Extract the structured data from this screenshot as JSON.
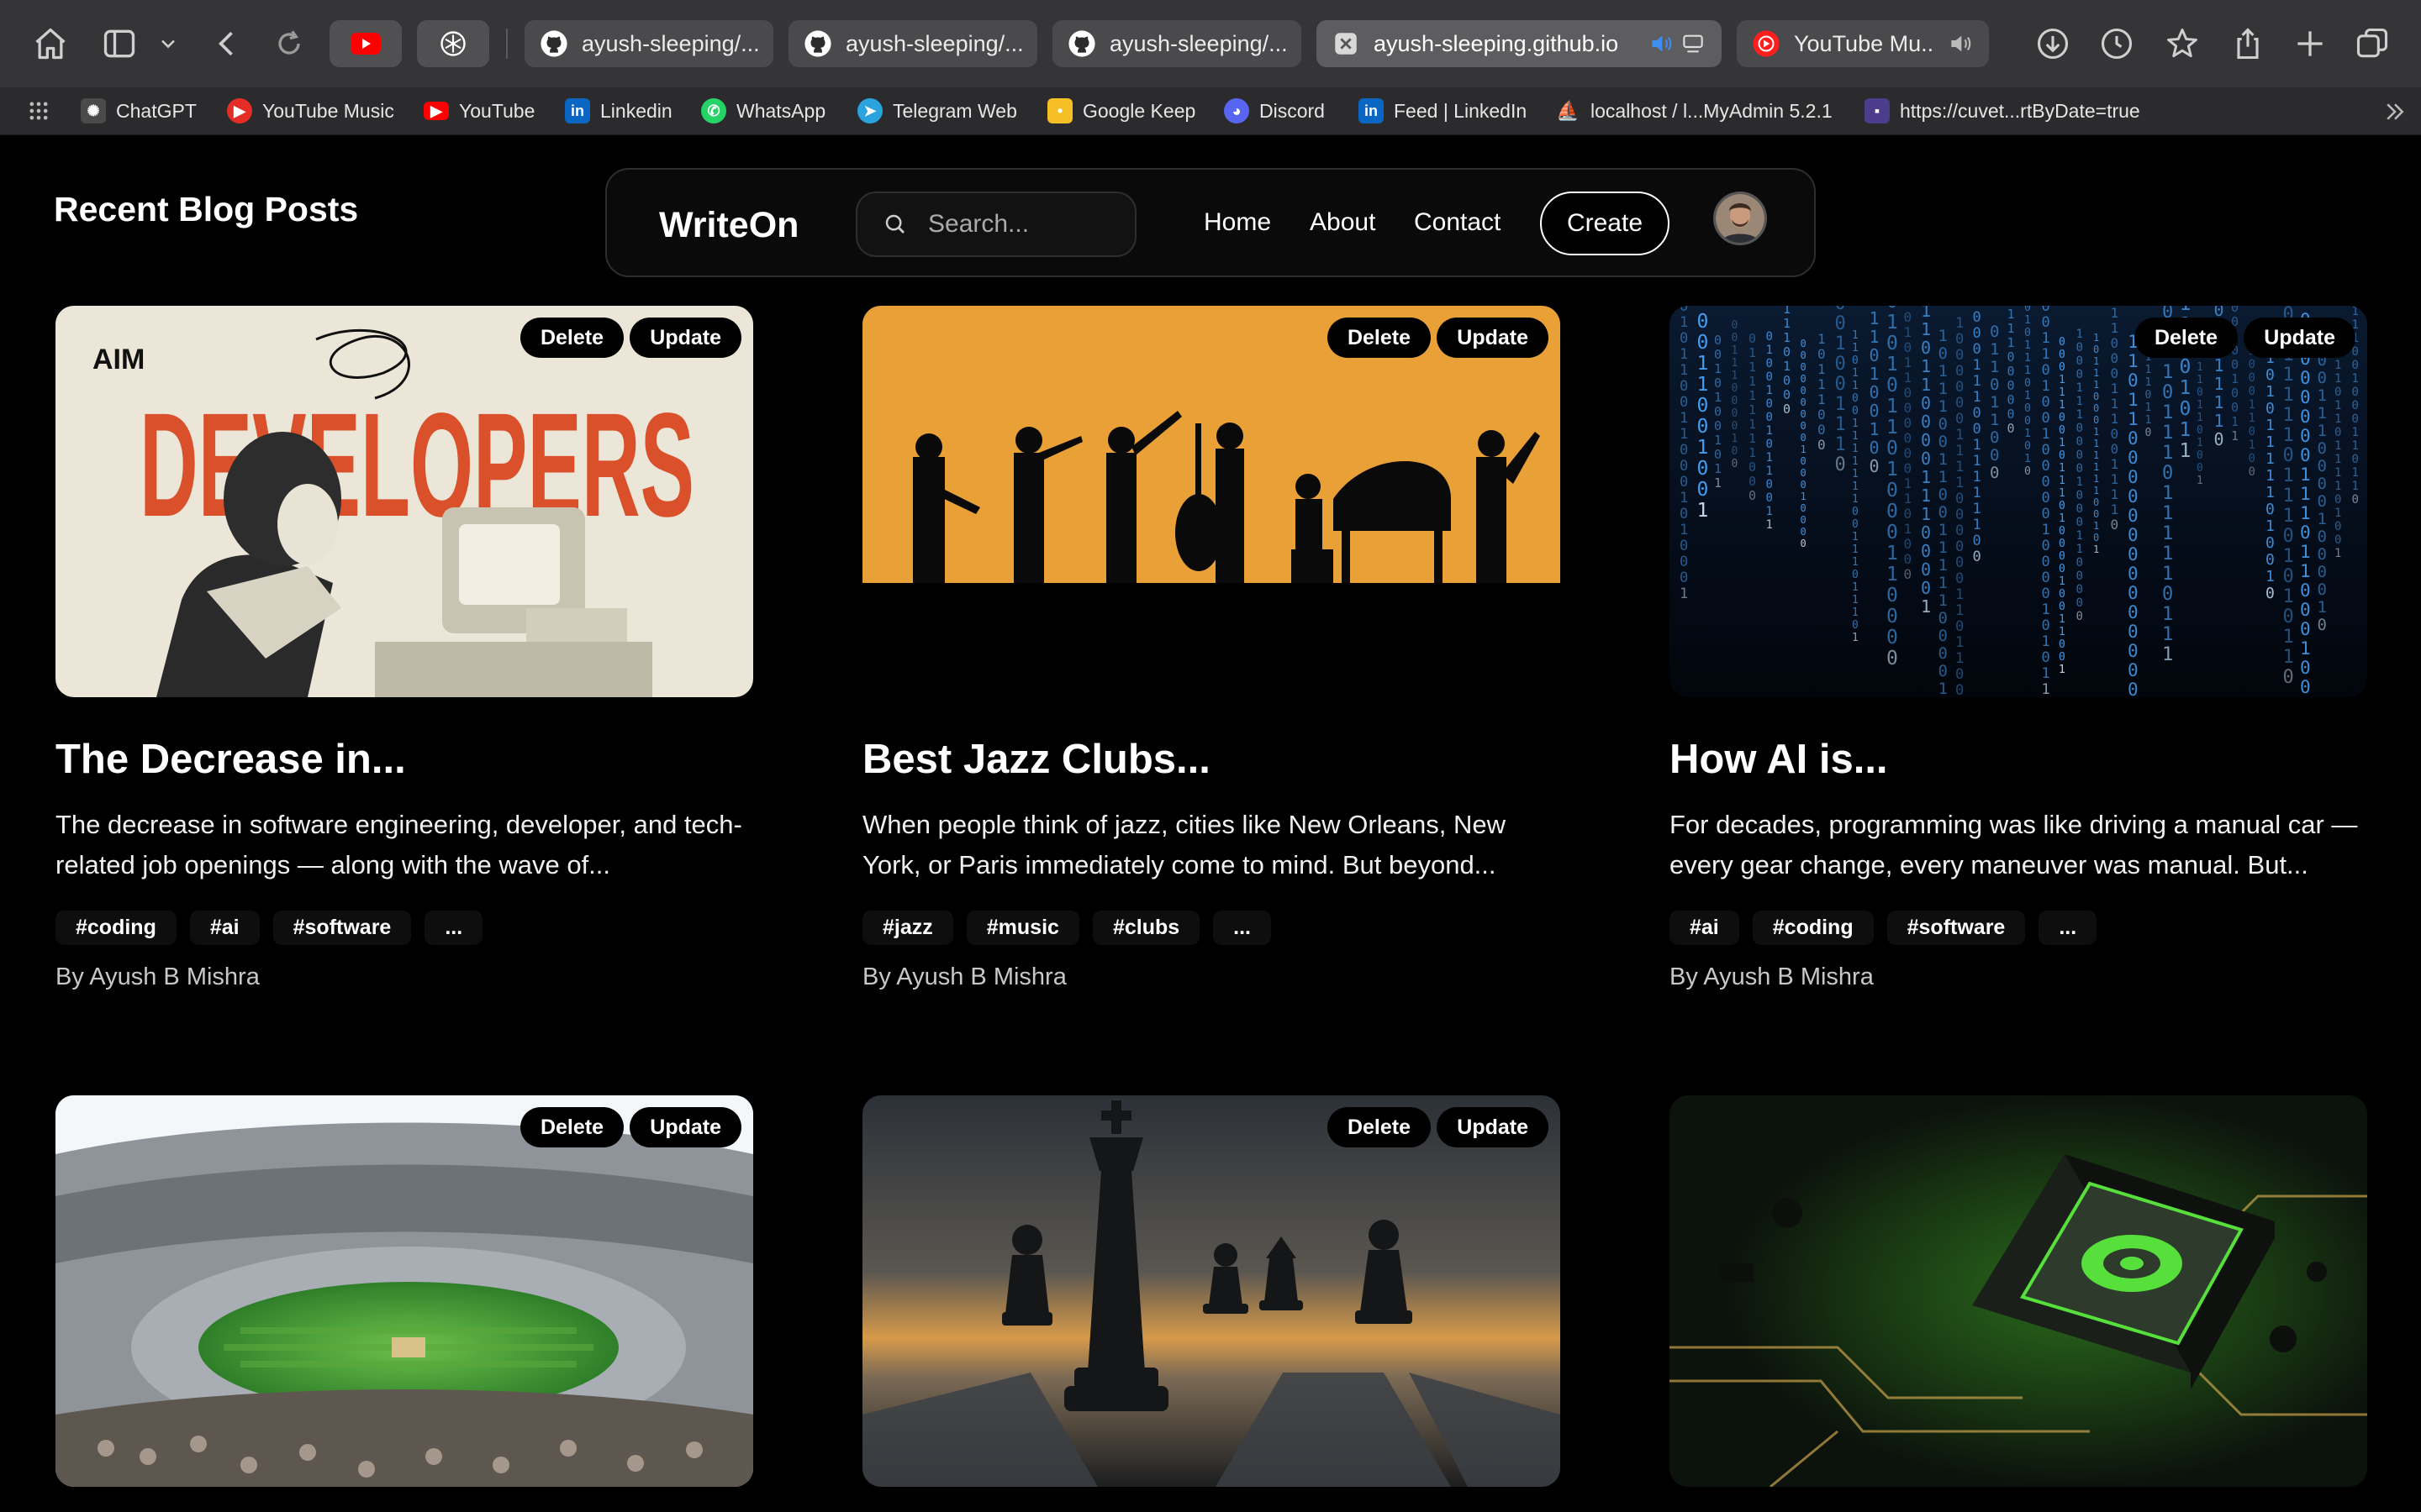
{
  "browser": {
    "tabs": [
      {
        "label": "ayush-sleeping/..."
      },
      {
        "label": "ayush-sleeping/..."
      },
      {
        "label": "ayush-sleeping/..."
      },
      {
        "label": "ayush-sleeping.github.io"
      },
      {
        "label": "YouTube Mu..."
      }
    ]
  },
  "bookmarks": [
    {
      "label": "ChatGPT",
      "color": "#4a4a4a"
    },
    {
      "label": "YouTube Music",
      "color": "#e52d27"
    },
    {
      "label": "YouTube",
      "color": "#ff0000"
    },
    {
      "label": "Linkedin",
      "color": "#0a66c2"
    },
    {
      "label": "WhatsApp",
      "color": "#25d366"
    },
    {
      "label": "Telegram Web",
      "color": "#2aa3df"
    },
    {
      "label": "Google Keep",
      "color": "#f6bf26"
    },
    {
      "label": "Discord",
      "color": "#5865f2"
    },
    {
      "label": "Feed | LinkedIn",
      "color": "#0a66c2"
    },
    {
      "label": "localhost / l...MyAdmin 5.2.1",
      "color": "#f29111"
    },
    {
      "label": "https://cuvet...rtByDate=true",
      "color": "#4b3c8c"
    }
  ],
  "page": {
    "heading": "Recent Blog Posts"
  },
  "nav": {
    "brand": "WriteOn",
    "search_placeholder": "Search...",
    "links": [
      "Home",
      "About",
      "Contact"
    ],
    "create_label": "Create"
  },
  "buttons": {
    "delete": "Delete",
    "update": "Update"
  },
  "posts": [
    {
      "title": "The Decrease in...",
      "excerpt": "The decrease in software engineering, developer, and tech-related job openings — along with the wave of...",
      "tags": [
        "#coding",
        "#ai",
        "#software",
        "..."
      ],
      "author": "By Ayush B Mishra",
      "image": "developers-poster"
    },
    {
      "title": "Best Jazz Clubs...",
      "excerpt": "When people think of jazz, cities like New Orleans, New York, or Paris immediately come to mind. But beyond...",
      "tags": [
        "#jazz",
        "#music",
        "#clubs",
        "..."
      ],
      "author": "By Ayush B Mishra",
      "image": "jazz-band-silhouette"
    },
    {
      "title": "How AI is...",
      "excerpt": "For decades, programming was like driving a manual car — every gear change, every maneuver was manual. But...",
      "tags": [
        "#ai",
        "#coding",
        "#software",
        "..."
      ],
      "author": "By Ayush B Mishra",
      "image": "binary-code-rain"
    },
    {
      "image": "cricket-stadium"
    },
    {
      "image": "chess-king"
    },
    {
      "image": "green-circuit-chip"
    }
  ],
  "colors": {
    "background": "#000000",
    "jazz_orange": "#e9a037",
    "matrix_blue": "#4aa8ff",
    "chip_green": "#57e03c"
  }
}
